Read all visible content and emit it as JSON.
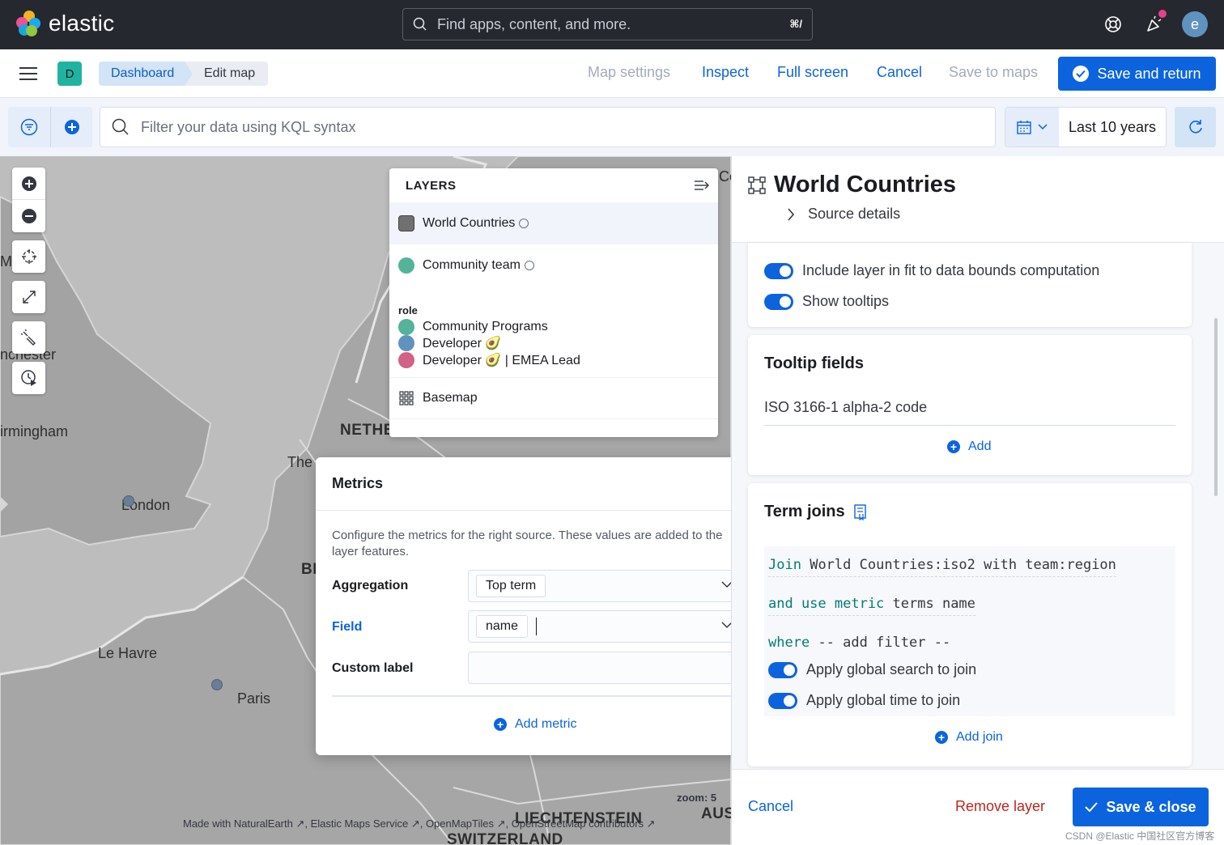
{
  "header": {
    "logo_text": "elastic",
    "search_placeholder": "Find apps, content, and more.",
    "search_shortcut": "⌘/",
    "avatar_initial": "e"
  },
  "appbar": {
    "space_initial": "D",
    "breadcrumbs": [
      "Dashboard",
      "Edit map"
    ],
    "links": {
      "map_settings": "Map settings",
      "inspect": "Inspect",
      "full_screen": "Full screen",
      "cancel": "Cancel",
      "save_to_maps": "Save to maps"
    },
    "save_and_return": "Save and return"
  },
  "querybar": {
    "kql_placeholder": "Filter your data using KQL syntax",
    "time_range": "Last 10 years"
  },
  "map": {
    "labels": {
      "birmingham": "irmingham",
      "london": "London",
      "le_havre": "Le Havre",
      "paris": "Paris",
      "netherlands": "NETHER",
      "the": "The",
      "nchester": "nchester",
      "m": "M",
      "bl": "BI",
      "liechtenstein": "LIECHTENSTEIN",
      "switzerland": "SWITZERLAND",
      "aus": "AUS",
      "co": "Co"
    },
    "zoom_text": "zoom: 5",
    "attribution": "Made with NaturalEarth ↗, Elastic Maps Service ↗, OpenMapTiles ↗, OpenStreetMap contributors ↗"
  },
  "layers": {
    "title": "LAYERS",
    "items": [
      {
        "name": "World Countries",
        "color": "#707070"
      },
      {
        "name": "Community team",
        "color": "#54b399"
      },
      {
        "name": "Basemap"
      }
    ],
    "legend": {
      "field": "role",
      "entries": [
        {
          "label": "Community Programs",
          "color": "#54b399"
        },
        {
          "label": "Developer 🥑",
          "color": "#6092c0"
        },
        {
          "label": "Developer 🥑 | EMEA Lead",
          "color": "#d36086"
        }
      ]
    }
  },
  "metrics": {
    "title": "Metrics",
    "description": "Configure the metrics for the right source. These values are added to the layer features.",
    "aggregation_label": "Aggregation",
    "aggregation_value": "Top term",
    "field_label": "Field",
    "field_value": "name",
    "custom_label": "Custom label",
    "custom_value": "",
    "add_metric": "Add metric"
  },
  "flyout": {
    "title": "World Countries",
    "source_details": "Source details",
    "toggles": {
      "fit_bounds": "Include layer in fit to data bounds computation",
      "show_tooltips": "Show tooltips"
    },
    "tooltip_fields": {
      "title": "Tooltip fields",
      "items": [
        "ISO 3166-1 alpha-2 code"
      ],
      "add": "Add"
    },
    "term_joins": {
      "title": "Term joins",
      "line1_kw": "Join",
      "line1_rest": "World Countries:iso2 with team:region",
      "line2_kw": "and use metric",
      "line2_rest": "terms name",
      "line3_kw": "where",
      "line3_rest": "-- add filter --",
      "apply_search": "Apply global search to join",
      "apply_time": "Apply global time to join",
      "add_join": "Add join"
    },
    "footer": {
      "cancel": "Cancel",
      "remove": "Remove layer",
      "save_close": "Save & close"
    }
  },
  "watermark": "CSDN @Elastic 中国社区官方博客"
}
